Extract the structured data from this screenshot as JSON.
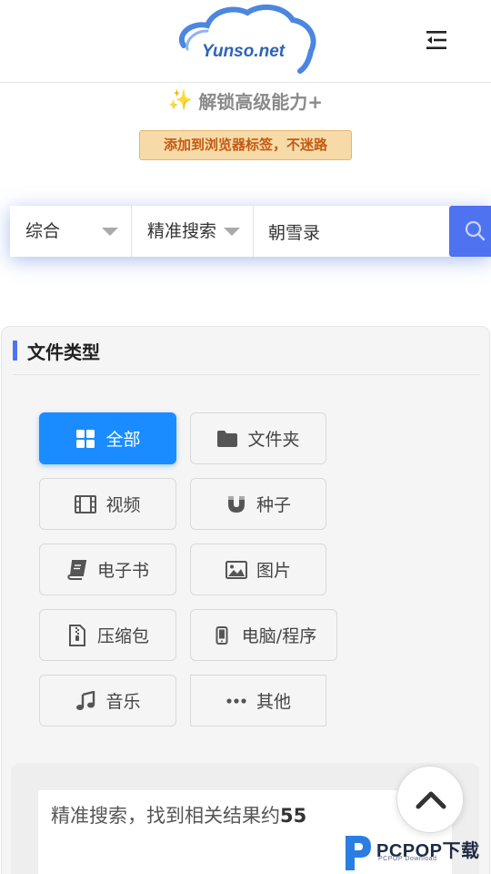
{
  "header": {
    "logo_text": "Yunso.net",
    "menu_icon": "menu-fold-icon"
  },
  "promo": {
    "unlock_text": "解锁高级能力+",
    "sparkle_icon": "sparkle-icon",
    "bookmark_text": "添加到浏览器标签，不迷路"
  },
  "search": {
    "scope_value": "综合",
    "mode_value": "精准搜索",
    "query_value": "朝雪录",
    "button_icon": "search-icon",
    "accent": "#4f72f0"
  },
  "file_types": {
    "title": "文件类型",
    "items": [
      {
        "label": "全部",
        "icon": "grid-icon",
        "active": true
      },
      {
        "label": "文件夹",
        "icon": "folder-icon",
        "active": false
      },
      {
        "label": "视频",
        "icon": "film-icon",
        "active": false
      },
      {
        "label": "种子",
        "icon": "magnet-icon",
        "active": false
      },
      {
        "label": "电子书",
        "icon": "book-icon",
        "active": false
      },
      {
        "label": "图片",
        "icon": "image-icon",
        "active": false
      },
      {
        "label": "压缩包",
        "icon": "zip-file-icon",
        "active": false
      },
      {
        "label": "电脑/程序",
        "icon": "mobile-icon",
        "active": false
      },
      {
        "label": "音乐",
        "icon": "music-icon",
        "active": false
      },
      {
        "label": "其他",
        "icon": "more-dots-icon",
        "active": false
      }
    ],
    "active_color": "#1a8cff"
  },
  "results": {
    "summary_prefix": "精准搜索，找到相关结果约",
    "count": "55"
  },
  "back_to_top": {
    "icon": "chevron-up-icon"
  },
  "watermark": {
    "brand": "PCPOP下载",
    "sub": "PCPOP Download"
  }
}
